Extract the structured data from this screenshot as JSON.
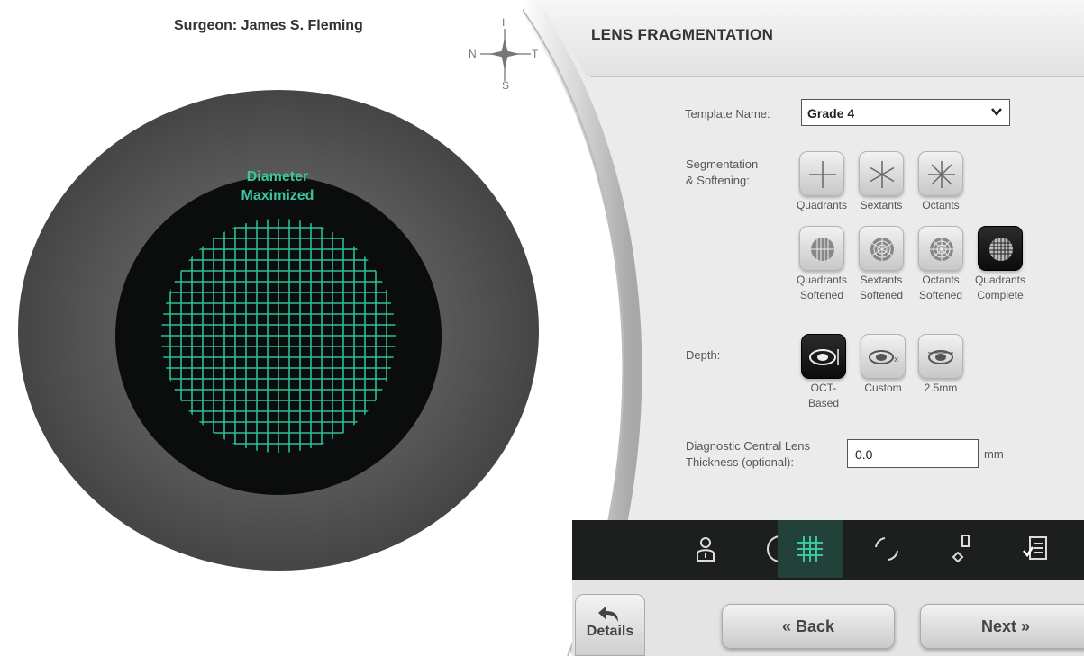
{
  "surgeon": "Surgeon: James S. Fleming",
  "compass": {
    "top": "I",
    "bottom": "S",
    "left": "N",
    "right": "T"
  },
  "overlay": {
    "line1": "Diameter",
    "line2": "Maximized"
  },
  "header": {
    "title": "LENS FRAGMENTATION"
  },
  "template": {
    "label": "Template Name:",
    "value": "Grade 4"
  },
  "segmentation": {
    "label_line1": "Segmentation",
    "label_line2": "& Softening:",
    "row1": [
      {
        "label1": "Quadrants",
        "label2": "",
        "icon": "quadrants-icon"
      },
      {
        "label1": "Sextants",
        "label2": "",
        "icon": "sextants-icon"
      },
      {
        "label1": "Octants",
        "label2": "",
        "icon": "octants-icon"
      }
    ],
    "row2": [
      {
        "label1": "Quadrants",
        "label2": "Softened",
        "icon": "quadrants-softened-icon"
      },
      {
        "label1": "Sextants",
        "label2": "Softened",
        "icon": "sextants-softened-icon"
      },
      {
        "label1": "Octants",
        "label2": "Softened",
        "icon": "octants-softened-icon"
      },
      {
        "label1": "Quadrants",
        "label2": "Complete",
        "icon": "quadrants-complete-icon",
        "selected": true
      }
    ]
  },
  "depth": {
    "label": "Depth:",
    "options": [
      {
        "label1": "OCT-",
        "label2": "Based",
        "selected": true
      },
      {
        "label1": "Custom",
        "label2": ""
      },
      {
        "label1": "2.5mm",
        "label2": ""
      }
    ]
  },
  "thickness": {
    "label_line1": "Diagnostic Central Lens",
    "label_line2": "Thickness (optional):",
    "value": "0.0",
    "unit": "mm"
  },
  "toolbar": [
    "patient-icon",
    "circle-icon",
    "grid-icon",
    "arc-icon",
    "marker-icon",
    "checklist-icon"
  ],
  "nav": {
    "details": "Details",
    "back": "Back",
    "next": "Next"
  },
  "colors": {
    "accent": "#3cc6a0",
    "toolbar": "#1d1f1f",
    "active_tab": "#224138"
  }
}
